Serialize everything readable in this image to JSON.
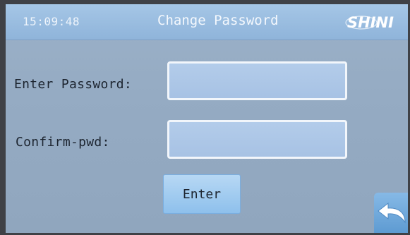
{
  "header": {
    "time": "15:09:48",
    "title": "Change Password",
    "logo_text": "SHINI"
  },
  "form": {
    "password_label": "Enter Password:",
    "password_value": "",
    "confirm_label": "Confirm-pwd:",
    "confirm_value": "",
    "enter_label": "Enter"
  },
  "icons": {
    "back": "undo-arrow-icon"
  },
  "colors": {
    "screen_bg": "#95abc3",
    "titlebar": "#9ec0e2",
    "field_fill": "#adc6e6",
    "button_fill": "#a3ccf0",
    "text": "#1d2530"
  }
}
